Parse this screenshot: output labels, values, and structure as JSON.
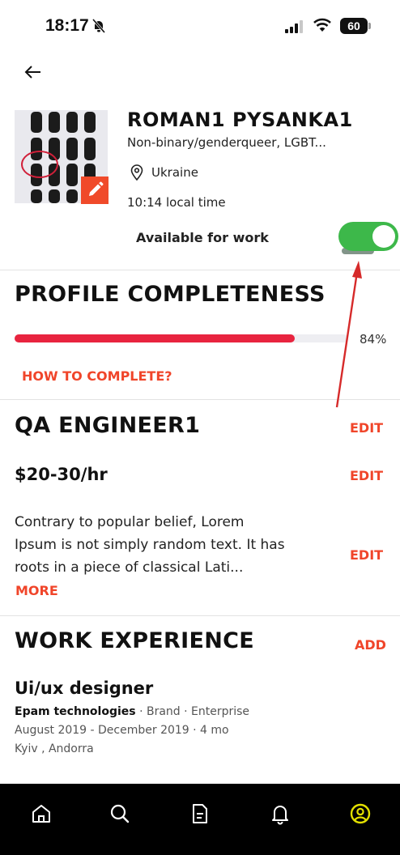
{
  "status_bar": {
    "time": "18:17",
    "battery": "60"
  },
  "profile": {
    "name": "ROMAN1 PYSANKA1",
    "gender": "Non-binary/genderqueer, LGBT...",
    "location": "Ukraine",
    "local_time": "10:14 local time",
    "available_label": "Available for work",
    "available": true
  },
  "completeness": {
    "title": "PROFILE COMPLETENESS",
    "percent_label": "84%",
    "percent": 84,
    "how_link": "HOW TO COMPLETE?"
  },
  "job": {
    "title": "QA ENGINEER1",
    "rate": "$20-30/hr",
    "bio": "Contrary to popular belief, Lorem Ipsum is not simply random text. It has roots in a piece of classical Lati...",
    "more": "MORE",
    "edit_label": "EDIT"
  },
  "experience": {
    "title": "WORK EXPERIENCE",
    "add_label": "ADD",
    "items": [
      {
        "role": "Ui/ux designer",
        "company": "Epam technologies",
        "tags": "· Brand · Enterprise",
        "dates": "August 2019 - December 2019 ·  4 mo",
        "place": "Kyiv , Andorra"
      }
    ]
  },
  "nav": [
    "home-icon",
    "search-icon",
    "document-icon",
    "bell-icon",
    "profile-icon"
  ],
  "colors": {
    "accent": "#f0452a",
    "progress": "#e8243f",
    "toggle": "#3db84a",
    "active_nav": "#e3e000"
  }
}
